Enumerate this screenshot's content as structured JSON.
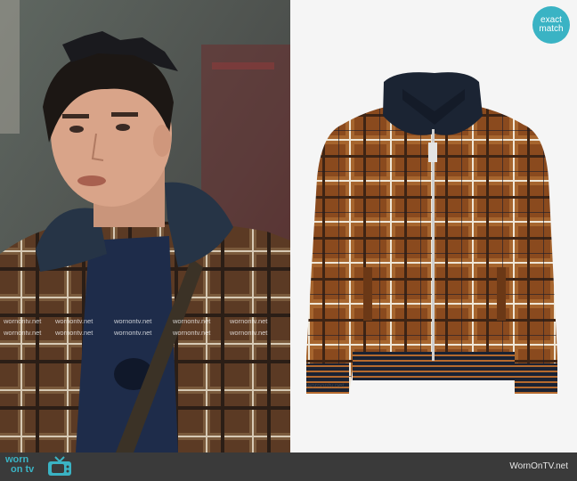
{
  "badge": {
    "line1": "exact",
    "line2": "match"
  },
  "watermark": {
    "text": "wornontv.net"
  },
  "footer": {
    "logo_line1": "worn",
    "logo_line2": "on tv",
    "site": "WornOnTV.net"
  },
  "colors": {
    "accent": "#3ab3c4",
    "footer_bg": "#3a3a3a",
    "plaid_brown": "#8a4a1e",
    "collar_navy": "#1b2433"
  },
  "icons": {
    "tv": "tv-icon"
  }
}
